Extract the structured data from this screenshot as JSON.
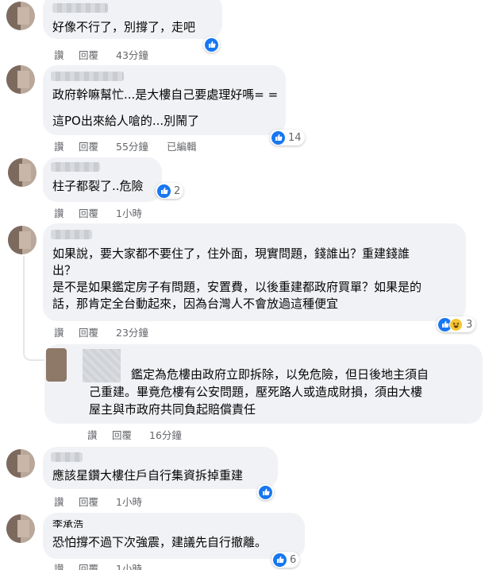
{
  "comments": [
    {
      "text_lines": [
        "好像不行了，別撐了，走吧"
      ],
      "actions": {
        "like": "讚",
        "reply": "回覆",
        "time": "43分鐘"
      },
      "reactions": {
        "count": ""
      }
    },
    {
      "text_lines": [
        "政府幹嘛幫忙...是大樓自己要處理好嗎= =",
        "這PO出來給人嗆的...別鬧了"
      ],
      "actions": {
        "like": "讚",
        "reply": "回覆",
        "time": "55分鐘",
        "edited": "已編輯"
      },
      "reactions": {
        "count": "14"
      }
    },
    {
      "text_lines": [
        "柱子都裂了..危險"
      ],
      "actions": {
        "like": "讚",
        "reply": "回覆",
        "time": "1小時"
      },
      "reactions": {
        "count": "2"
      }
    },
    {
      "text_lines": [
        "如果說，要大家都不要住了，住外面，現實問題，錢誰出？重建錢誰",
        "出？",
        "是不是如果鑑定房子有問題，安置費，以後重建都政府買單？如果是的",
        "話，那肯定全台動起來，因為台灣人不會放過這種便宜"
      ],
      "actions": {
        "like": "讚",
        "reply": "回覆",
        "time": "23分鐘"
      },
      "reactions": {
        "count": "3"
      }
    },
    {
      "text_lines": [
        "鑑定為危樓由政府立即拆除，以免危險，但日後地主須自",
        "己重建。畢竟危樓有公安問題，壓死路人或造成財損，須由大樓",
        "屋主與市政府共同負起賠償責任"
      ],
      "actions": {
        "like": "讚",
        "reply": "回覆",
        "time": "16分鐘"
      }
    },
    {
      "text_lines": [
        "應該星鑽大樓住戶自行集資拆掉重建"
      ],
      "actions": {
        "like": "讚",
        "reply": "回覆",
        "time": "1小時"
      },
      "reactions": {
        "count": ""
      }
    },
    {
      "name_partial": "李承浩",
      "text_lines": [
        "恐怕撐不過下次強震，建議先自行撤離。"
      ],
      "actions": {
        "like": "讚",
        "reply": "回覆",
        "time": "1小時"
      },
      "reactions": {
        "count": "6"
      }
    }
  ],
  "icons": {
    "like": "like-icon",
    "haha": "haha-icon"
  },
  "colors": {
    "bubble": "#f0f2f5",
    "meta": "#65676b",
    "like_blue": "#1877f2"
  }
}
